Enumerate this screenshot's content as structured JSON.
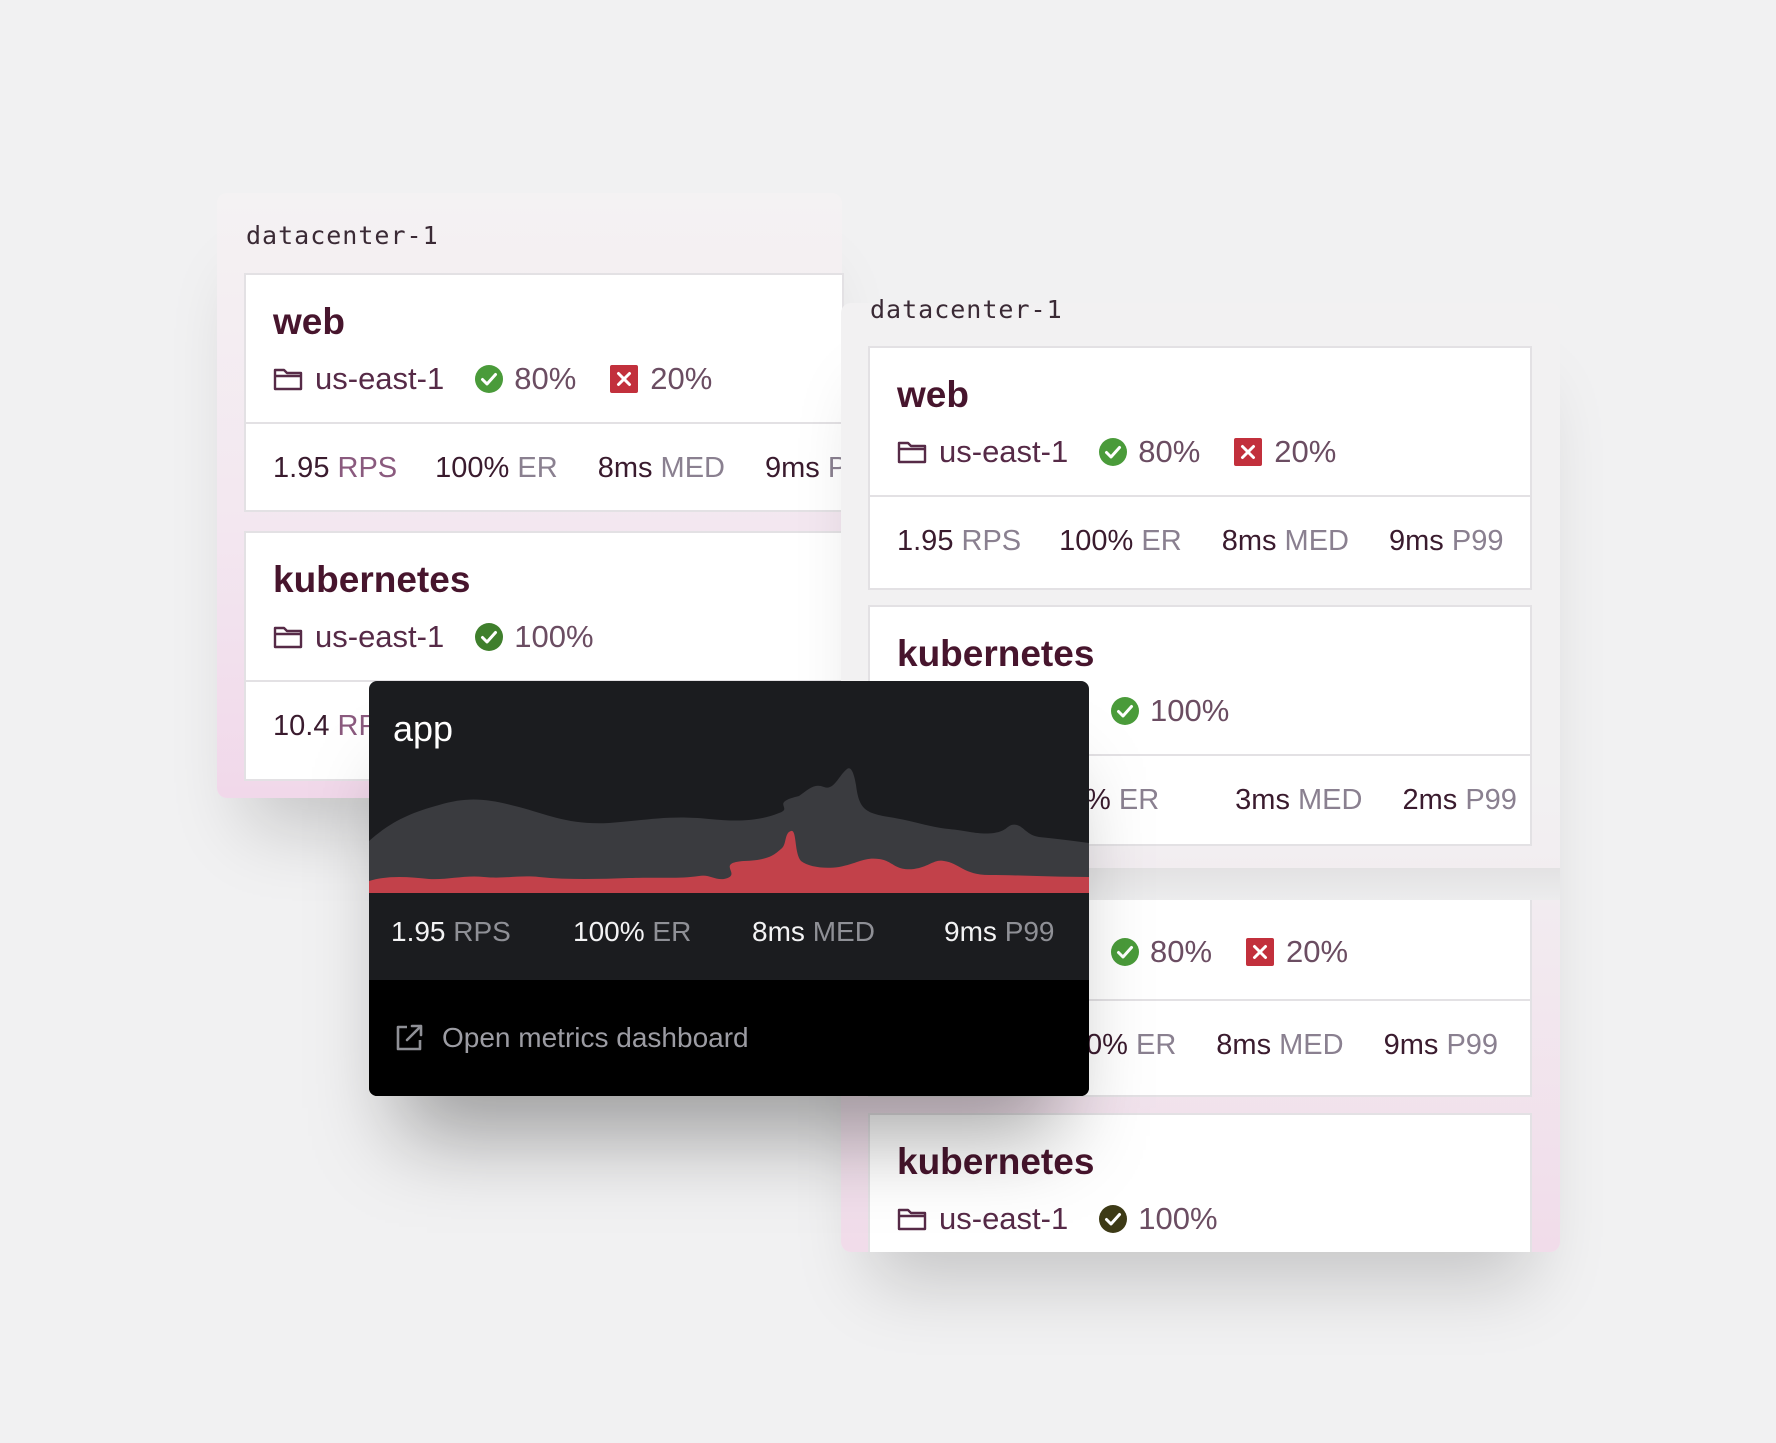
{
  "colors": {
    "ok_green": "#4a9b3a",
    "error_red": "#c2303c",
    "title_plum": "#47152d",
    "chart_gray": "#3a3b3f",
    "chart_red": "#c2414a"
  },
  "left_panel": {
    "label": "datacenter-1",
    "web": {
      "title": "web",
      "region": "us-east-1",
      "ok_pct": "80%",
      "err_pct": "20%",
      "stats": [
        {
          "value": "1.95",
          "unit": "RPS"
        },
        {
          "value": "100%",
          "unit": "ER"
        },
        {
          "value": "8ms",
          "unit": "MED"
        },
        {
          "value": "9ms",
          "unit": "P"
        }
      ]
    },
    "kubernetes": {
      "title": "kubernetes",
      "region": "us-east-1",
      "ok_pct": "100%",
      "stats": [
        {
          "value": "10.4",
          "unit": "RP"
        }
      ]
    }
  },
  "right_panel": {
    "label": "datacenter-1",
    "web": {
      "title": "web",
      "region": "us-east-1",
      "ok_pct": "80%",
      "err_pct": "20%",
      "stats": [
        {
          "value": "1.95",
          "unit": "RPS"
        },
        {
          "value": "100%",
          "unit": "ER"
        },
        {
          "value": "8ms",
          "unit": "MED"
        },
        {
          "value": "9ms",
          "unit": "P99"
        }
      ]
    },
    "kubernetes": {
      "title": "kubernetes",
      "ok_pct": "100%",
      "stats": [
        {
          "value": "%",
          "unit": "ER"
        },
        {
          "value": "3ms",
          "unit": "MED"
        },
        {
          "value": "2ms",
          "unit": "P99"
        }
      ]
    },
    "web2": {
      "ok_pct": "80%",
      "err_pct": "20%",
      "stats": [
        {
          "value": "0%",
          "unit": "ER"
        },
        {
          "value": "8ms",
          "unit": "MED"
        },
        {
          "value": "9ms",
          "unit": "P99"
        }
      ]
    },
    "kubernetes2": {
      "title": "kubernetes",
      "region": "us-east-1",
      "ok_pct": "100%"
    }
  },
  "popover": {
    "title": "app",
    "stats": [
      {
        "value": "1.95",
        "unit": "RPS"
      },
      {
        "value": "100%",
        "unit": "ER"
      },
      {
        "value": "8ms",
        "unit": "MED"
      },
      {
        "value": "9ms",
        "unit": "P99"
      }
    ],
    "link_label": "Open metrics dashboard",
    "link_icon": "external-link-icon"
  }
}
